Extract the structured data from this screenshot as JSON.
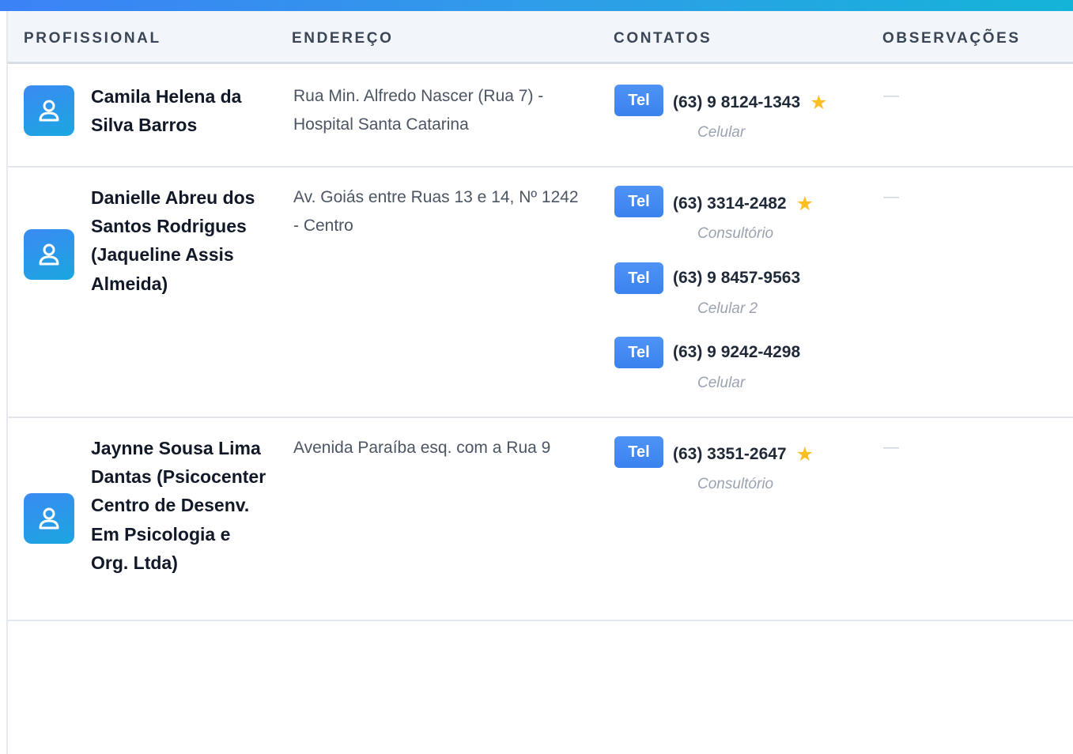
{
  "header": {
    "col_profissional": "PROFISSIONAL",
    "col_endereco": "ENDEREÇO",
    "col_contatos": "CONTATOS",
    "col_observacoes": "OBSERVAÇÕES"
  },
  "rows": [
    {
      "name": "Camila Helena da Silva Barros",
      "address": "Rua Min. Alfredo Nascer (Rua 7) - Hospital Santa Catarina",
      "observations": "—",
      "contacts": [
        {
          "badge": "Tel",
          "phone": "(63) 9 8124-1343",
          "starred": true,
          "type": "Celular"
        }
      ]
    },
    {
      "name": "Danielle Abreu dos Santos Rodrigues (Jaqueline Assis Almeida)",
      "address": "Av. Goiás entre Ruas 13 e 14, Nº 1242 - Centro",
      "observations": "—",
      "contacts": [
        {
          "badge": "Tel",
          "phone": "(63) 3314-2482",
          "starred": true,
          "type": "Consultório"
        },
        {
          "badge": "Tel",
          "phone": "(63) 9 8457-9563",
          "starred": false,
          "type": "Celular 2"
        },
        {
          "badge": "Tel",
          "phone": "(63) 9 9242-4298",
          "starred": false,
          "type": "Celular"
        }
      ]
    },
    {
      "name": "Jaynne Sousa Lima Dantas (Psicocenter Centro de Desenv. Em Psicologia e Org. Ltda)",
      "address": "Avenida Paraíba esq. com a Rua 9",
      "observations": "—",
      "contacts": [
        {
          "badge": "Tel",
          "phone": "(63) 3351-2647",
          "starred": true,
          "type": "Consultório"
        }
      ]
    }
  ],
  "icons": {
    "avatar": "user-icon",
    "favorite": "star-icon",
    "star_glyph": "★"
  },
  "colors": {
    "accent": "#3b82f6",
    "gradient_end": "#14b4d8",
    "star": "#fbbf24"
  }
}
